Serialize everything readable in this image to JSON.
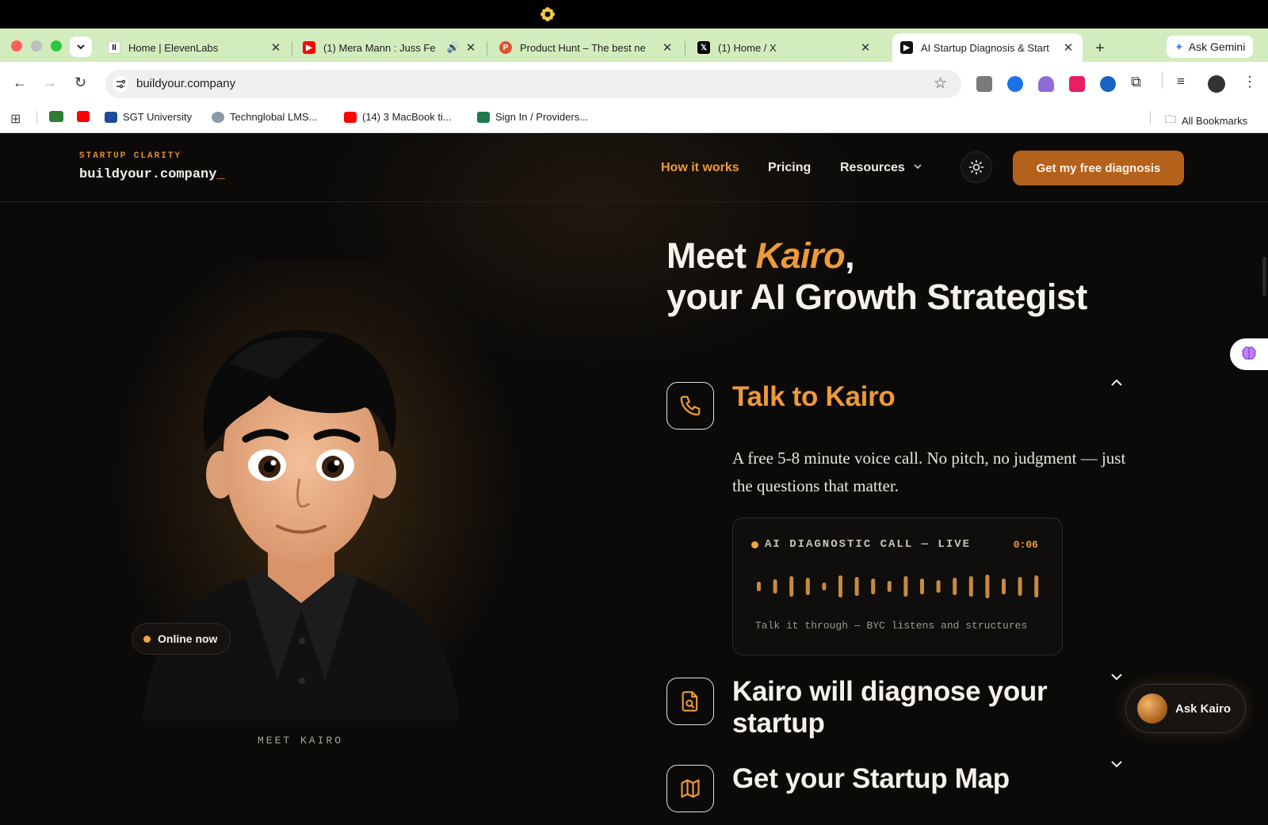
{
  "browser": {
    "tabs": [
      {
        "title": "Home | ElevenLabs",
        "favicon": "elevenlabs-icon",
        "color": "#ffffff"
      },
      {
        "title": "(1) Mera Mann : Juss Fe",
        "favicon": "youtube-icon",
        "color": "#ff0000"
      },
      {
        "title": "Product Hunt – The best ne",
        "favicon": "producthunt-icon",
        "color": "#da552f"
      },
      {
        "title": "(1) Home / X",
        "favicon": "x-icon",
        "color": "#000000"
      },
      {
        "title": "AI Startup Diagnosis & Start",
        "favicon": "site-icon",
        "color": "#111111"
      }
    ],
    "ask_gemini": "Ask Gemini",
    "url": "buildyour.company",
    "bookmarks": [
      {
        "label": "SGT University"
      },
      {
        "label": "Techngloba​l LMS..."
      },
      {
        "label": "(14) 3 MacBook ti..."
      },
      {
        "label": "Sign In / Providers..."
      }
    ],
    "all_bookmarks": "All Bookmarks"
  },
  "site": {
    "brand_tag": "STARTUP CLARITY",
    "brand_name": "buildyour.company",
    "brand_cursor": "_",
    "nav": {
      "how_it_works": "How it works",
      "pricing": "Pricing",
      "resources": "Resources"
    },
    "cta": "Get my free diagnosis",
    "accent": "#ee9a3a"
  },
  "hero": {
    "title_pre": "Meet ",
    "title_name": "Kairo",
    "title_comma": ",",
    "title_line2": "your AI Growth Strategist",
    "online_badge": "Online now",
    "caption": "MEET KAIRO"
  },
  "steps": [
    {
      "title": "Talk to Kairo",
      "icon": "phone-icon",
      "expanded": true,
      "description": "A free 5-8 minute voice call. No pitch, no judgment — just the questions that matter."
    },
    {
      "title": "Kairo will diagnose your startup",
      "icon": "file-search-icon",
      "expanded": false
    },
    {
      "title": "Get your Startup Map",
      "icon": "map-icon",
      "expanded": false
    }
  ],
  "call_card": {
    "label": "AI DIAGNOSTIC CALL — LIVE",
    "timer": "0:06",
    "footer": "Talk it through — BYC listens and structures"
  },
  "ask_kairo": "Ask Kairo"
}
